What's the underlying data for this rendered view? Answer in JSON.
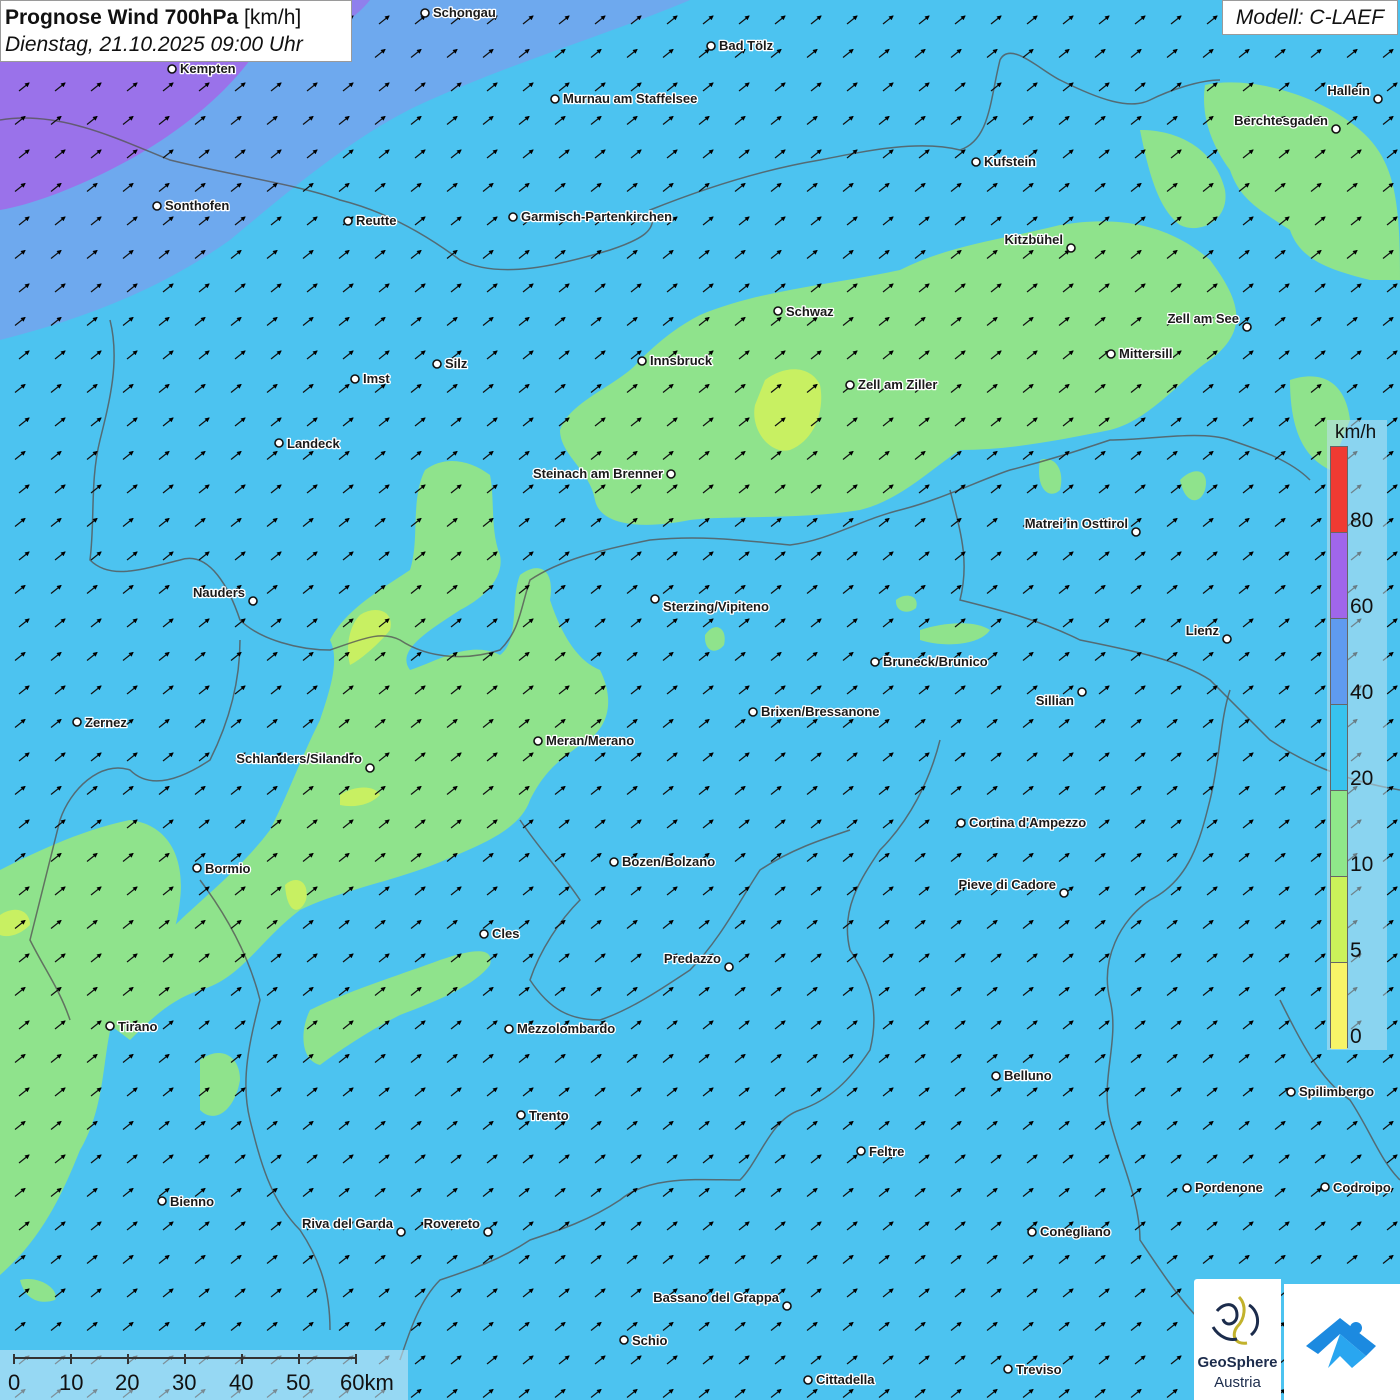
{
  "header": {
    "title_bold": "Prognose Wind 700hPa",
    "title_unit": "[km/h]",
    "datetime": "Dienstag, 21.10.2025 09:00 Uhr",
    "model": "Modell: C-LAEF"
  },
  "legend": {
    "unit": "km/h",
    "ticks": [
      "80",
      "60",
      "40",
      "20",
      "10",
      "5",
      "0"
    ],
    "colors": {
      "above_80": "#f03a32",
      "60_80": "#a066ea",
      "40_60": "#5f9bf0",
      "20_40": "#38c3ee",
      "10_20": "#8fe78a",
      "5_10": "#cbf25a",
      "0_5": "#f8f468"
    }
  },
  "scale": {
    "labels": [
      "0",
      "10",
      "20",
      "30",
      "40",
      "50",
      "60km"
    ]
  },
  "cities": [
    {
      "name": "Schongau"
    },
    {
      "name": "Bad Tölz"
    },
    {
      "name": "Kempten"
    },
    {
      "name": "Murnau am Staffelsee"
    },
    {
      "name": "Hallein"
    },
    {
      "name": "Berchtesgaden"
    },
    {
      "name": "Kufstein"
    },
    {
      "name": "Sonthofen"
    },
    {
      "name": "Reutte"
    },
    {
      "name": "Garmisch-Partenkirchen"
    },
    {
      "name": "Kitzbühel"
    },
    {
      "name": "Schwaz"
    },
    {
      "name": "Zell am See"
    },
    {
      "name": "Mittersill"
    },
    {
      "name": "Innsbruck"
    },
    {
      "name": "Silz"
    },
    {
      "name": "Imst"
    },
    {
      "name": "Zell am Ziller"
    },
    {
      "name": "Landeck"
    },
    {
      "name": "Steinach am Brenner"
    },
    {
      "name": "Matrei in Osttirol"
    },
    {
      "name": "Nauders"
    },
    {
      "name": "Sterzing/Vipiteno"
    },
    {
      "name": "Lienz"
    },
    {
      "name": "Bruneck/Brunico"
    },
    {
      "name": "Sillian"
    },
    {
      "name": "Brixen/Bressanone"
    },
    {
      "name": "Zernez"
    },
    {
      "name": "Meran/Merano"
    },
    {
      "name": "Schlanders/Silandro"
    },
    {
      "name": "Cortina d'Ampezzo"
    },
    {
      "name": "Bozen/Bolzano"
    },
    {
      "name": "Bormio"
    },
    {
      "name": "Pieve di Cadore"
    },
    {
      "name": "Cles"
    },
    {
      "name": "Predazzo"
    },
    {
      "name": "Tirano"
    },
    {
      "name": "Mezzolombardo"
    },
    {
      "name": "Belluno"
    },
    {
      "name": "Spilimbergo"
    },
    {
      "name": "Trento"
    },
    {
      "name": "Feltre"
    },
    {
      "name": "Pordenone"
    },
    {
      "name": "Codroipo"
    },
    {
      "name": "Bienno"
    },
    {
      "name": "Riva del Garda"
    },
    {
      "name": "Rovereto"
    },
    {
      "name": "Conegliano"
    },
    {
      "name": "Bassano del Grappa"
    },
    {
      "name": "Schio"
    },
    {
      "name": "Treviso"
    },
    {
      "name": "Cittadella"
    }
  ],
  "logos": {
    "geosphere_name": "GeoSphere",
    "geosphere_sub": "Austria"
  }
}
